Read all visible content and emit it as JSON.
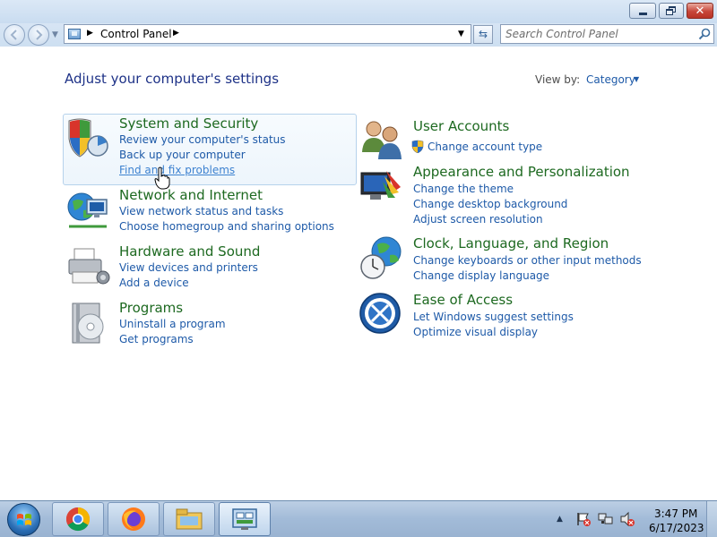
{
  "window": {
    "minimize_label": "minimize",
    "maximize_label": "maximize",
    "close_label": "close"
  },
  "address_bar": {
    "breadcrumb": "Control Panel",
    "search_placeholder": "Search Control Panel"
  },
  "header": {
    "title": "Adjust your computer's settings",
    "view_by_label": "View by:",
    "view_by_value": "Category"
  },
  "categories": [
    {
      "title": "System and Security",
      "icon": "shield-icon",
      "links": [
        "Review your computer's status",
        "Back up your computer",
        "Find and fix problems"
      ]
    },
    {
      "title": "Network and Internet",
      "icon": "network-globe-icon",
      "links": [
        "View network status and tasks",
        "Choose homegroup and sharing options"
      ]
    },
    {
      "title": "Hardware and Sound",
      "icon": "printer-icon",
      "links": [
        "View devices and printers",
        "Add a device"
      ]
    },
    {
      "title": "Programs",
      "icon": "programs-disc-icon",
      "links": [
        "Uninstall a program",
        "Get programs"
      ]
    },
    {
      "title": "User Accounts",
      "icon": "users-icon",
      "links": [
        "Change account type"
      ]
    },
    {
      "title": "Appearance and Personalization",
      "icon": "monitor-paint-icon",
      "links": [
        "Change the theme",
        "Change desktop background",
        "Adjust screen resolution"
      ]
    },
    {
      "title": "Clock, Language, and Region",
      "icon": "clock-globe-icon",
      "links": [
        "Change keyboards or other input methods",
        "Change display language"
      ]
    },
    {
      "title": "Ease of Access",
      "icon": "ease-of-access-icon",
      "links": [
        "Let Windows suggest settings",
        "Optimize visual display"
      ]
    }
  ],
  "taskbar": {
    "pinned": [
      "chrome-icon",
      "firefox-icon",
      "file-explorer-icon",
      "control-panel-icon"
    ],
    "tray_icons": [
      "action-center-icon",
      "network-icon",
      "volume-muted-icon"
    ],
    "time": "3:47 PM",
    "date": "6/17/2023"
  },
  "colors": {
    "category_title": "#1d6920",
    "link": "#1e5aa8",
    "heading": "#1e3287"
  }
}
